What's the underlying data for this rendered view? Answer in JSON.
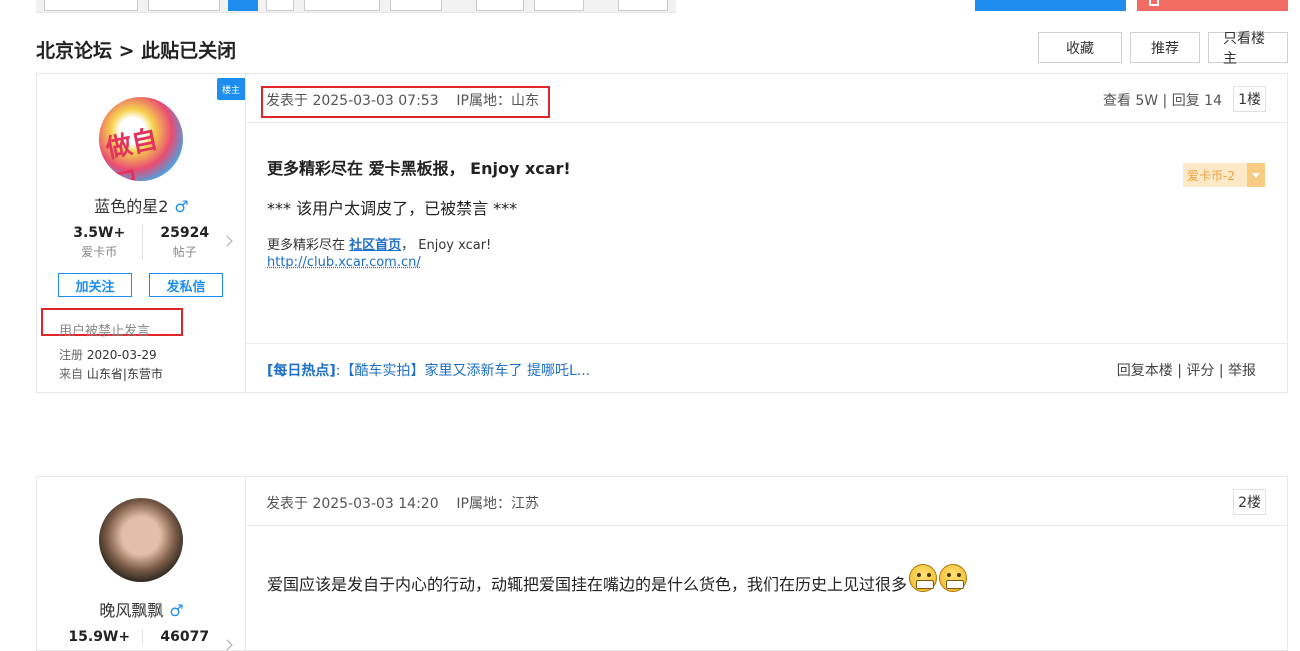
{
  "thread": {
    "breadcrumb": "北京论坛 >  此贴已关闭",
    "tools": {
      "favorite": "收藏",
      "recommend": "推荐",
      "only_host": "只看楼主"
    }
  },
  "posts": [
    {
      "host_tag": "楼主",
      "username": "蓝色的星2",
      "gender_icon": "♂",
      "coins": "3.5W+",
      "coins_label": "爱卡币",
      "posts": "25924",
      "posts_label": "帖子",
      "follow_label": "加关注",
      "message_label": "发私信",
      "status": "用户被禁止发言",
      "reg_label": "注册",
      "reg_date": "2020-03-29",
      "from_label": "来自",
      "from_place": "山东省|东营市",
      "meta": "发表于 2025-03-03 07:53    IP属地：山东",
      "views": "查看 5W | 回复 14",
      "floor": "1楼",
      "coin_badge": "爱卡币-2",
      "content_bold": "更多精彩尽在 爱卡黑板报， Enjoy xcar!",
      "content_line": "*** 该用户太调皮了，已被禁言 ***",
      "content_small_prefix": "更多精彩尽在 ",
      "content_small_link": "社区首页",
      "content_small_suffix": "， Enjoy xcar!",
      "content_url": "http://club.xcar.com.cn/",
      "hot_label": "[每日热点]",
      "hot_text": ":【酷车实拍】家里又添新车了 提哪吒L...",
      "ops": "回复本楼 | 评分 | 举报"
    },
    {
      "username": "晚风飘飘",
      "gender_icon": "♂",
      "coins": "15.9W+",
      "posts": "46077",
      "meta": "发表于 2025-03-03 14:20    IP属地：江苏",
      "floor": "2楼",
      "content": "爱国应该是发自于内心的行动，动辄把爱国挂在嘴边的是什么货色，我们在历史上见过很多"
    }
  ]
}
